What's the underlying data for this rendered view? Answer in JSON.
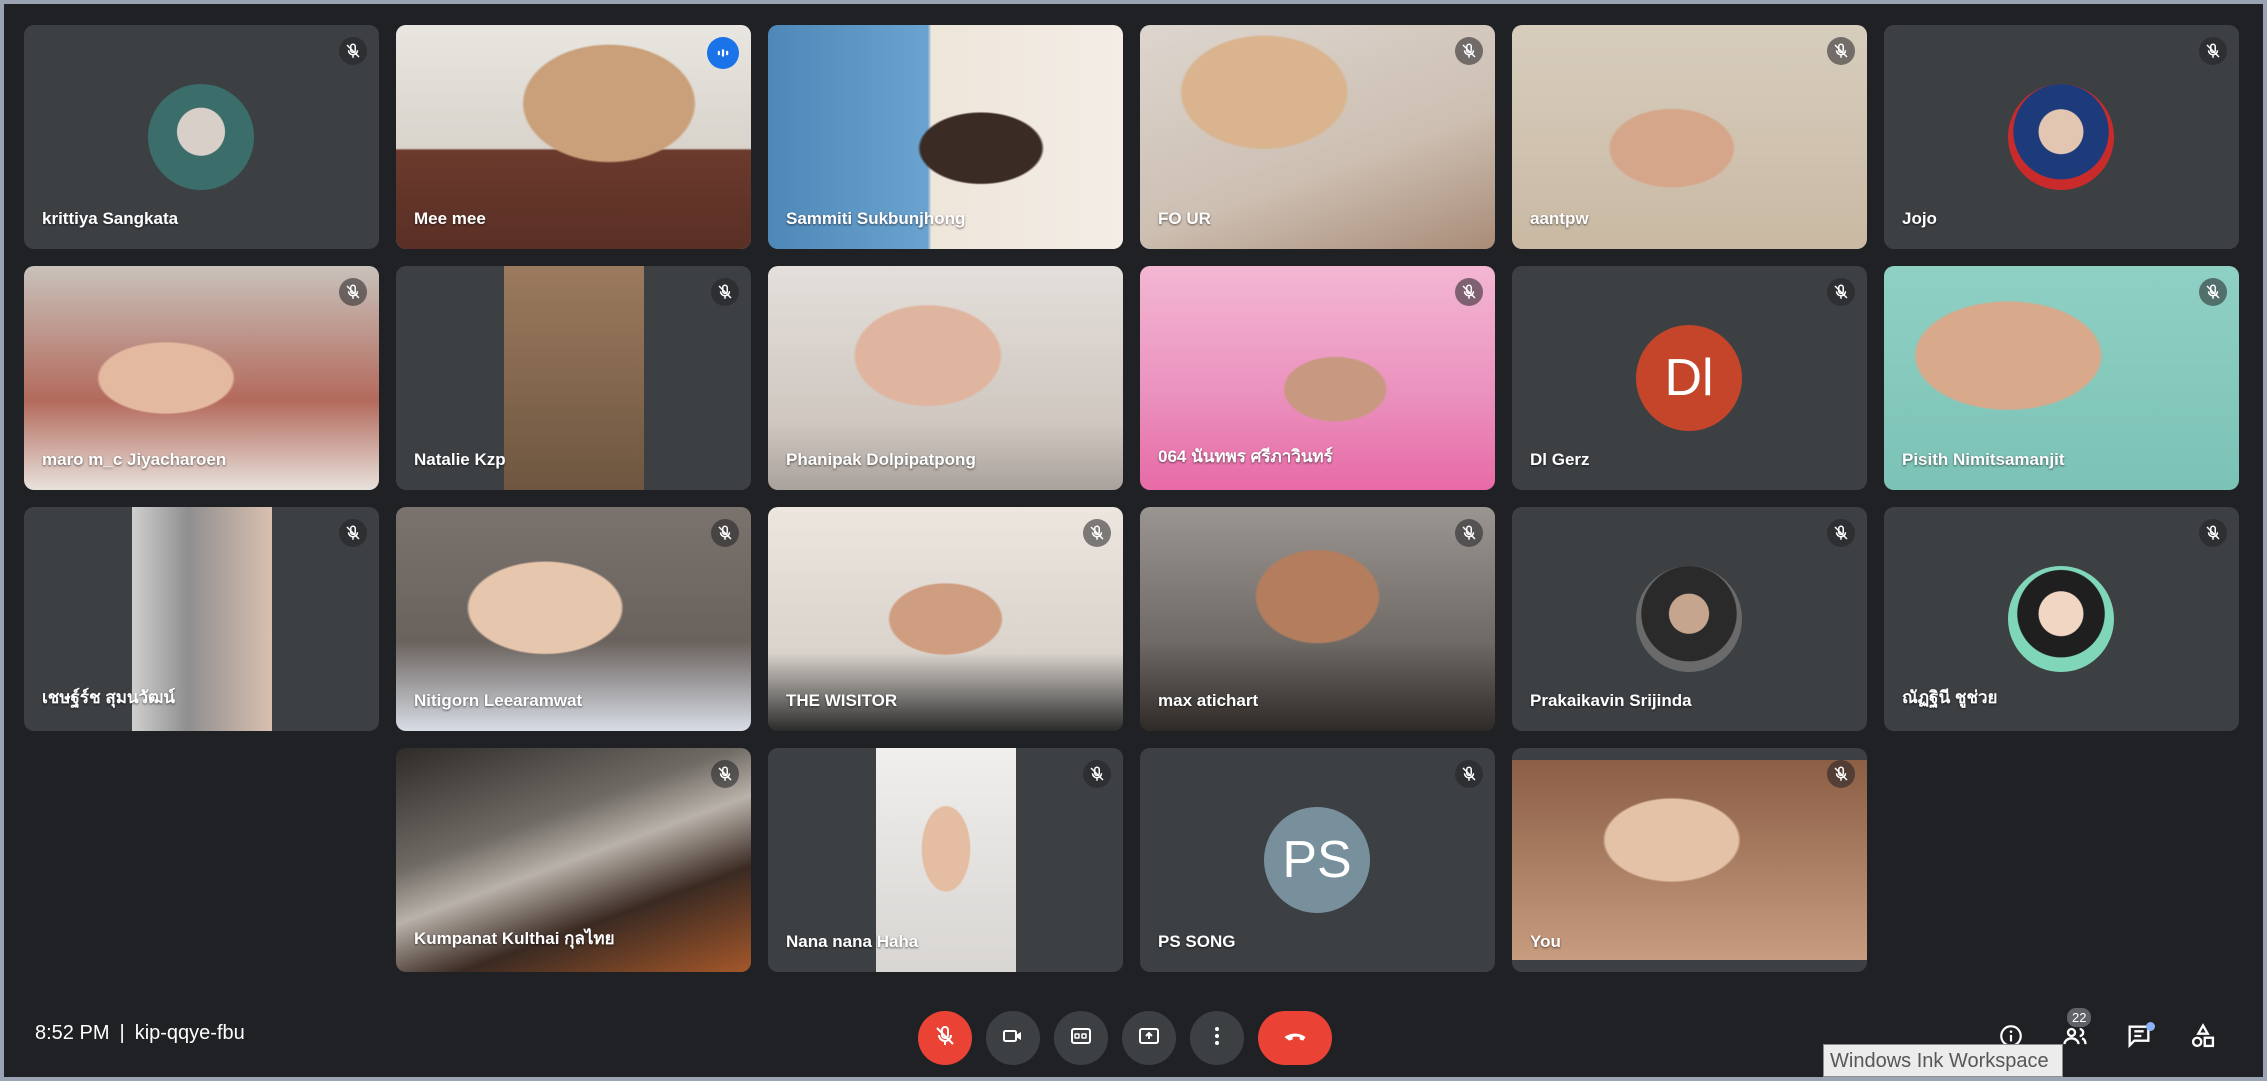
{
  "participants": [
    {
      "name": "krittiya Sangkata",
      "tile": "avatar",
      "avatar_icon": "profile-photo-icon"
    },
    {
      "name": "Mee mee",
      "tile": "video",
      "speaking": true
    },
    {
      "name": "Sammiti Sukbunjhong",
      "tile": "video"
    },
    {
      "name": "FO UR",
      "tile": "video"
    },
    {
      "name": "aantpw",
      "tile": "video"
    },
    {
      "name": "Jojo",
      "tile": "avatar",
      "avatar_icon": "profile-photo-icon"
    },
    {
      "name": "maro m_c Jiyacharoen",
      "tile": "video"
    },
    {
      "name": "Natalie Kzp",
      "tile": "video"
    },
    {
      "name": "Phanipak Dolpipatpong",
      "tile": "video"
    },
    {
      "name": "064 นันทพร ศรีภาวินทร์",
      "tile": "video"
    },
    {
      "name": "Dl Gerz",
      "tile": "initials",
      "initials": "Dl",
      "color": "#c5452b"
    },
    {
      "name": "Pisith Nimitsamanjit",
      "tile": "video"
    },
    {
      "name": "เชษฐ์ร์ช สุมนวัฒน์",
      "tile": "video"
    },
    {
      "name": "Nitigorn Leearamwat",
      "tile": "video"
    },
    {
      "name": "THE WISITOR",
      "tile": "video"
    },
    {
      "name": "max atichart",
      "tile": "video"
    },
    {
      "name": "Prakaikavin Srijinda",
      "tile": "avatar",
      "avatar_icon": "profile-photo-icon"
    },
    {
      "name": "ณัฏฐินี ชูช่วย",
      "tile": "avatar",
      "avatar_icon": "profile-photo-icon"
    },
    {
      "name": "Kumpanat Kulthai กุลไทย",
      "tile": "video"
    },
    {
      "name": "Nana nana Haha",
      "tile": "video"
    },
    {
      "name": "PS SONG",
      "tile": "initials",
      "initials": "PS",
      "color": "#78909c"
    },
    {
      "name": "You",
      "tile": "video"
    }
  ],
  "bottom_bar": {
    "time": "8:52 PM",
    "separator": "|",
    "meeting_code": "kip-qqye-fbu",
    "controls": [
      "mic-off-icon",
      "camera-icon",
      "captions-icon",
      "present-icon",
      "more-options-icon",
      "end-call-icon"
    ],
    "right_icons": [
      "info-icon",
      "people-icon",
      "chat-icon",
      "activities-icon"
    ],
    "people_count": "22"
  },
  "tooltip": {
    "text": "Windows Ink Workspace"
  },
  "colors": {
    "background": "#202124",
    "tile": "#3c4043",
    "mic_off_button": "#ea4335",
    "end_call_button": "#ea4335",
    "speaking_indicator": "#1a73e8",
    "active_speaker_border": "#8ab4f8"
  }
}
